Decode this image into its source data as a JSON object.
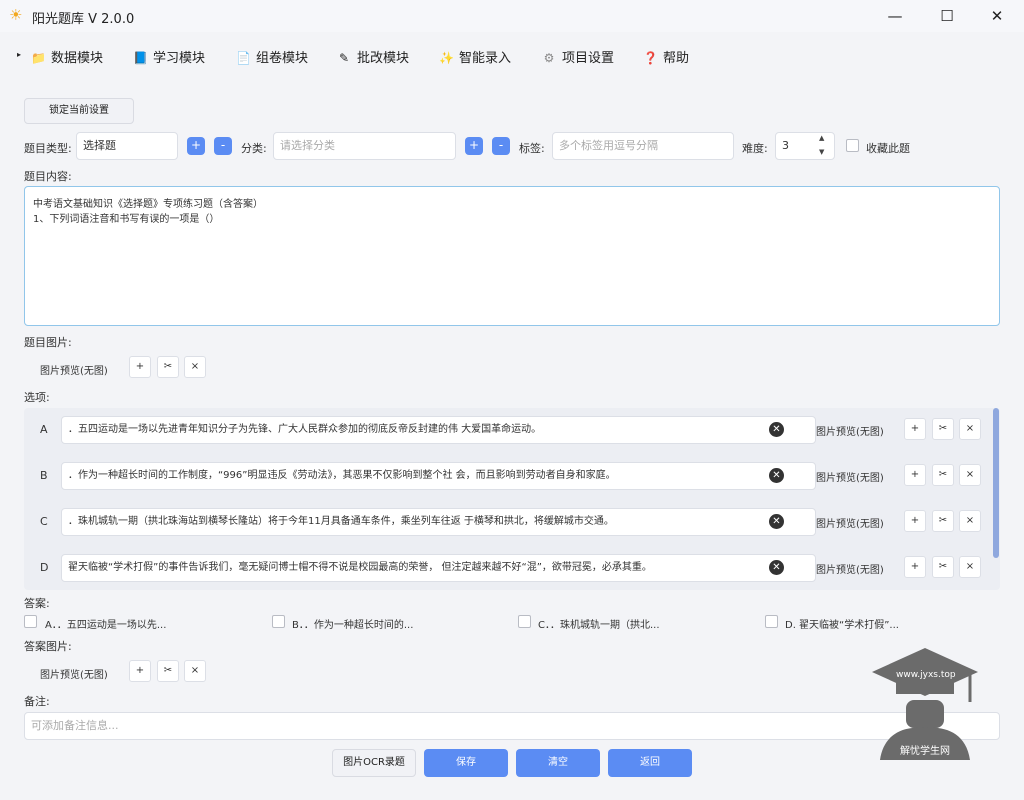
{
  "window": {
    "title": "阳光题库 V 2.0.0",
    "minimize": "—",
    "maximize": "☐",
    "close": "✕"
  },
  "menu": {
    "items": [
      {
        "label": "数据模块",
        "icon": "folder-icon",
        "glyph": "📁"
      },
      {
        "label": "学习模块",
        "icon": "book-icon",
        "glyph": "📘"
      },
      {
        "label": "组卷模块",
        "icon": "document-icon",
        "glyph": "📄"
      },
      {
        "label": "批改模块",
        "icon": "pen-icon",
        "glyph": "✎"
      },
      {
        "label": "智能录入",
        "icon": "sparkle-icon",
        "glyph": "✨"
      },
      {
        "label": "项目设置",
        "icon": "gear-icon",
        "glyph": "⚙"
      },
      {
        "label": "帮助",
        "icon": "help-icon",
        "glyph": "❓"
      }
    ]
  },
  "form": {
    "lock_button": "锁定当前设置",
    "type_label": "题目类型:",
    "type_value": "选择题",
    "category_label": "分类:",
    "category_placeholder": "请选择分类",
    "tags_label": "标签:",
    "tags_placeholder": "多个标签用逗号分隔",
    "difficulty_label": "难度:",
    "difficulty_value": "3",
    "favorite_label": "收藏此题",
    "content_label": "题目内容:",
    "content_line1": "中考语文基础知识《选择题》专项练习题（含答案）",
    "content_line2": "1、下列词语注音和书写有误的一项是（）",
    "image_label": "题目图片:",
    "image_preview": "图片预览(无图)",
    "options_label": "选项:",
    "answer_label": "答案:",
    "answer_image_label": "答案图片:",
    "answer_image_preview": "图片预览(无图)",
    "note_label": "备注:",
    "note_placeholder": "可添加备注信息..."
  },
  "options": [
    {
      "letter": "A",
      "text": "．五四运动是一场以先进青年知识分子为先锋、广大人民群众参加的彻底反帝反封建的伟 大爱国革命运动。",
      "preview": "图片预览(无图)"
    },
    {
      "letter": "B",
      "text": "．作为一种超长时间的工作制度，“996”明显违反《劳动法》，其恶果不仅影响到整个社 会，而且影响到劳动者自身和家庭。",
      "preview": "图片预览(无图)"
    },
    {
      "letter": "C",
      "text": "．珠机城轨一期（拱北珠海站到横琴长隆站）将于今年11月具备通车条件，乘坐列车往返 于横琴和拱北，将缓解城市交通。",
      "preview": "图片预览(无图)"
    },
    {
      "letter": "D",
      "text": "翟天临被“学术打假”的事件告诉我们，毫无疑问博士帽不得不说是校园最高的荣誉， 但注定越来越不好“混”，欲带冠冕，必承其重。",
      "preview": "图片预览(无图)"
    }
  ],
  "answers": [
    {
      "label": "A．．五四运动是一场以先..."
    },
    {
      "label": "B．．作为一种超长时间的..."
    },
    {
      "label": "C．．珠机城轨一期（拱北..."
    },
    {
      "label": "D. 翟天临被“学术打假”..."
    }
  ],
  "small_buttons": {
    "add": "+",
    "cut": "✂",
    "remove": "×"
  },
  "add_symbol": "+",
  "remove_symbol": "-",
  "bottom": {
    "ocr": "图片OCR录题",
    "save": "保存",
    "clear": "清空",
    "back": "返回"
  },
  "watermark": {
    "url": "www.jyxs.top",
    "name": "解忧学生网"
  },
  "colors": {
    "primary": "#5b8cf3",
    "border": "#dcdfe6",
    "focus": "#91c6ea"
  }
}
